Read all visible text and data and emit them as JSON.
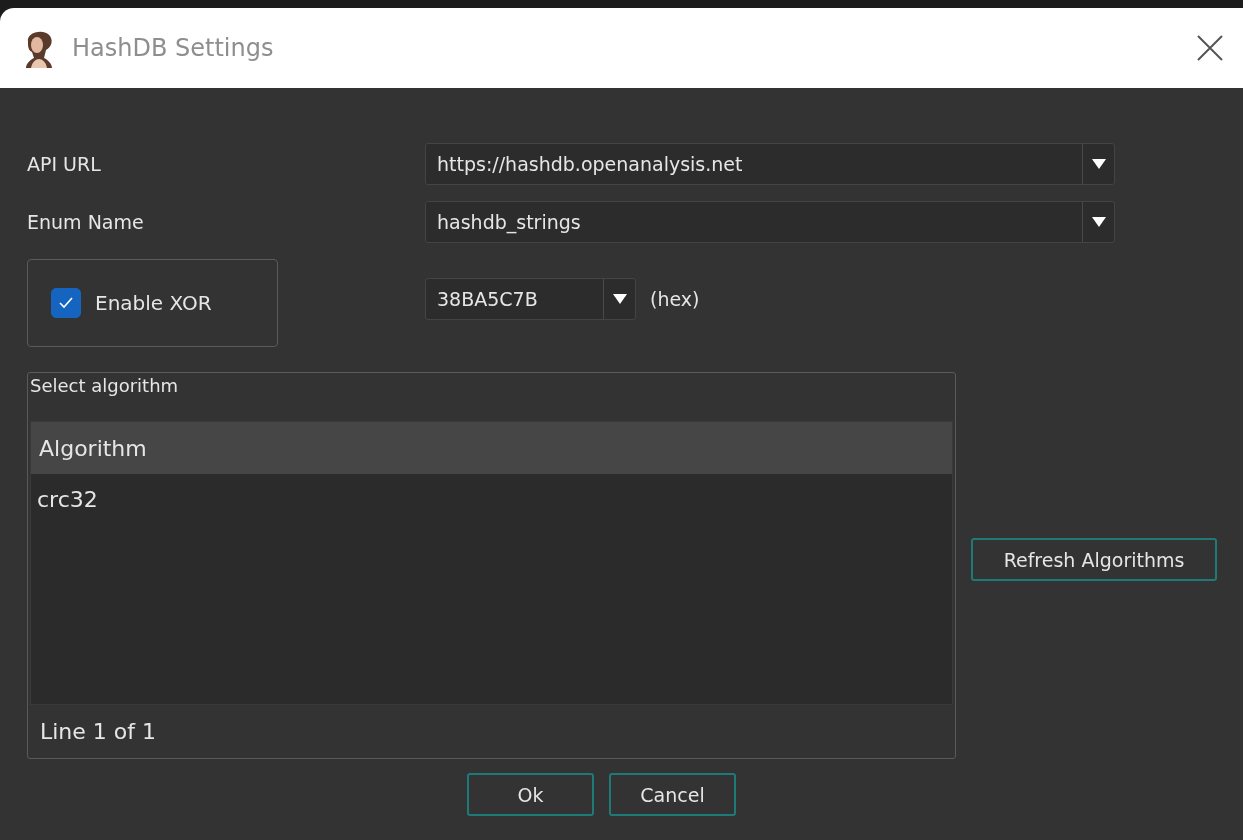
{
  "window": {
    "title": "HashDB Settings"
  },
  "fields": [
    {
      "label": "API URL",
      "value": "https://hashdb.openanalysis.net"
    },
    {
      "label": "Enum Name",
      "value": "hashdb_strings"
    }
  ],
  "xor": {
    "label": "Enable XOR",
    "checked": true,
    "value": "38BA5C7B",
    "unit": "(hex)"
  },
  "algorithm_group": {
    "title": "Select algorithm",
    "column": "Algorithm",
    "rows": [
      {
        "name": "crc32",
        "selected": false
      }
    ],
    "status": "Line 1 of 1"
  },
  "refresh_button": "Refresh Algorithms",
  "buttons": [
    "Ok",
    "Cancel"
  ]
}
